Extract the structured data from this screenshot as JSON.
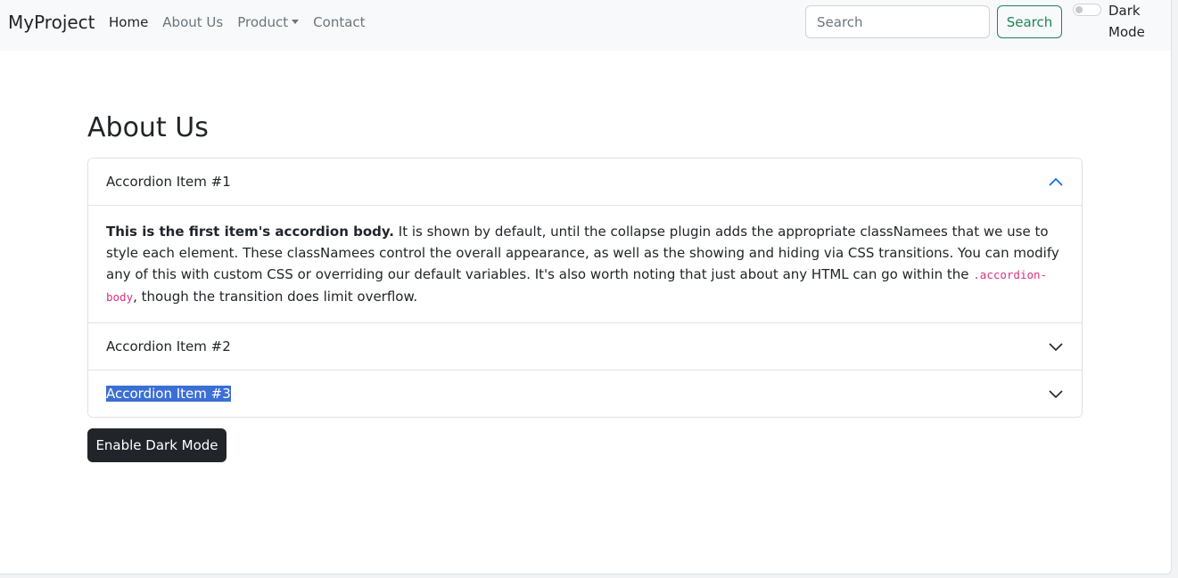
{
  "navbar": {
    "brand": "MyProject",
    "links": [
      {
        "label": "Home"
      },
      {
        "label": "About Us"
      },
      {
        "label": "Product"
      },
      {
        "label": "Contact"
      }
    ],
    "search": {
      "placeholder": "Search",
      "value": "",
      "button_label": "Search"
    },
    "dark_mode_toggle": {
      "label": "Dark Mode",
      "checked": false
    }
  },
  "main": {
    "title": "About Us",
    "accordion": [
      {
        "label": "Accordion Item #1",
        "expanded": true,
        "body": {
          "strong": "This is the first item's accordion body.",
          "text_before_code": " It is shown by default, until the collapse plugin adds the appropriate classNamees that we use to style each element. These classNamees control the overall appearance, as well as the showing and hiding via CSS transitions. You can modify any of this with custom CSS or overriding our default variables. It's also worth noting that just about any HTML can go within the ",
          "code": ".accordion-body",
          "text_after_code": ", though the transition does limit overflow."
        }
      },
      {
        "label": "Accordion Item #2",
        "expanded": false
      },
      {
        "label": "Accordion Item #3",
        "expanded": false,
        "text_selected": true
      }
    ],
    "dark_mode_button": "Enable Dark Mode"
  },
  "colors": {
    "navbar_bg": "#f8f9fa",
    "search_outline": "#198754",
    "dark_button": "#212529",
    "code_text": "#d63384",
    "chevron_open": "#0c63e4",
    "selection": "#3b6fd4"
  },
  "icons": {
    "open_chevron": "chevron-up-icon",
    "closed_chevron": "chevron-down-icon",
    "dropdown_caret": "caret-down-icon"
  }
}
